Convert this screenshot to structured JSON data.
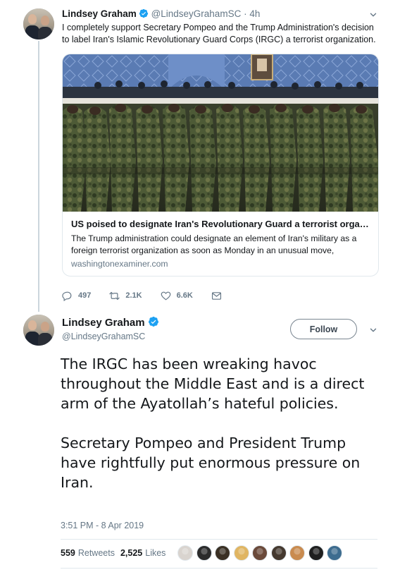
{
  "tweet1": {
    "author_name": "Lindsey Graham",
    "author_handle": "@LindseyGrahamSC",
    "separator": "·",
    "time_ago": "4h",
    "text": "I completely support Secretary Pompeo and the Trump Administration's decision to label Iran's Islamic Revolutionary Guard Corps (IRGC) a terrorist organization.",
    "card": {
      "title": "US poised to designate Iran's Revolutionary Guard a terrorist organi...",
      "description": "The Trump administration could designate an element of Iran's military as a foreign terrorist organization as soon as Monday in an unusual move,",
      "domain": "washingtonexaminer.com"
    },
    "actions": {
      "replies": "497",
      "retweets": "2.1K",
      "likes": "6.6K"
    }
  },
  "tweet2": {
    "author_name": "Lindsey Graham",
    "author_handle": "@LindseyGrahamSC",
    "follow_label": "Follow",
    "paragraphs": [
      "The IRGC has been wreaking havoc throughout the Middle East and is a direct arm of the Ayatollah’s hateful policies.",
      "Secretary Pompeo and President Trump have rightfully put enormous pressure on Iran."
    ],
    "timestamp": "3:51 PM - 8 Apr 2019",
    "stats": {
      "retweets_count": "559",
      "retweets_label": "Retweets",
      "likes_count": "2,525",
      "likes_label": "Likes"
    },
    "liker_colors": [
      "#d9d4cf",
      "#2b2b2b",
      "#3a3024",
      "#e0b562",
      "#6b4a3a",
      "#45392f",
      "#c98b4f",
      "#1f1f1f",
      "#3d6c8f"
    ]
  },
  "colors": {
    "verified": "#1da1f2",
    "secondary_text": "#657786",
    "border": "#e1e8ed"
  },
  "icons": {
    "verified": "verified-badge-icon",
    "caret": "chevron-down-icon",
    "reply": "reply-icon",
    "retweet": "retweet-icon",
    "like": "heart-icon",
    "dm": "envelope-icon"
  }
}
